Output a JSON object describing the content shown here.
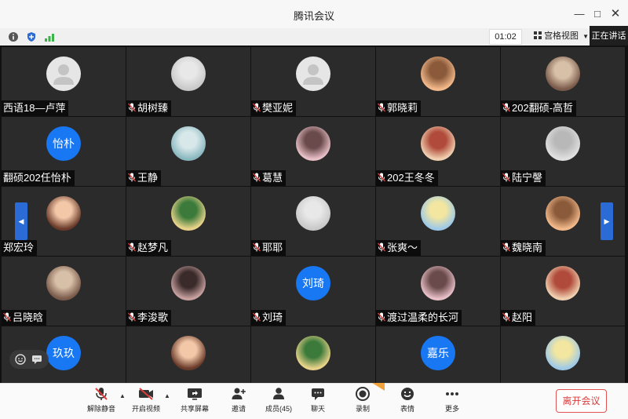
{
  "window": {
    "title": "腾讯会议"
  },
  "infobar": {
    "timer": "01:02",
    "grid_view": "宫格视图",
    "speaking": "正在讲话"
  },
  "colors": {
    "avatar_blue": "#1877f2",
    "leave_red": "#d93a3a",
    "pager_blue": "#2b6bd6",
    "signal_green": "#3cb34a"
  },
  "participants": [
    {
      "name": "西语18—卢萍",
      "avatar": "default-grey",
      "muted": false
    },
    {
      "name": "胡树臻",
      "avatar": "photo",
      "muted": true
    },
    {
      "name": "樊亚妮",
      "avatar": "default-grey",
      "muted": true
    },
    {
      "name": "郭晓莉",
      "avatar": "photo",
      "muted": true
    },
    {
      "name": "202翻硕-高哲",
      "avatar": "photo",
      "muted": true
    },
    {
      "name": "翻硕202任怡朴",
      "avatar": "text",
      "avatar_text": "怡朴",
      "muted": false
    },
    {
      "name": "王静",
      "avatar": "photo",
      "muted": true
    },
    {
      "name": "葛慧",
      "avatar": "photo",
      "muted": true
    },
    {
      "name": "202王冬冬",
      "avatar": "photo",
      "muted": true
    },
    {
      "name": "陆宁謦",
      "avatar": "photo",
      "muted": true
    },
    {
      "name": "郑宏玲",
      "avatar": "photo",
      "muted": false
    },
    {
      "name": "赵梦凡",
      "avatar": "photo",
      "muted": true
    },
    {
      "name": "耶耶",
      "avatar": "photo",
      "muted": true
    },
    {
      "name": "张爽～",
      "avatar": "photo",
      "muted": true
    },
    {
      "name": "魏晓南",
      "avatar": "photo",
      "muted": true
    },
    {
      "name": "吕晓晗",
      "avatar": "photo",
      "muted": true
    },
    {
      "name": "李浚歌",
      "avatar": "photo",
      "muted": true
    },
    {
      "name": "刘琦",
      "avatar": "text",
      "avatar_text": "刘琦",
      "muted": true
    },
    {
      "name": "渡过温柔的长河",
      "avatar": "photo",
      "muted": true
    },
    {
      "name": "赵阳",
      "avatar": "photo",
      "muted": true
    },
    {
      "name": "",
      "avatar": "text",
      "avatar_text": "玖玖",
      "muted": false
    },
    {
      "name": "",
      "avatar": "photo",
      "muted": false
    },
    {
      "name": "",
      "avatar": "photo",
      "muted": false
    },
    {
      "name": "",
      "avatar": "text",
      "avatar_text": "嘉乐",
      "muted": false
    },
    {
      "name": "",
      "avatar": "photo",
      "muted": false
    }
  ],
  "toolbar": {
    "unmute": "解除静音",
    "video": "开启视频",
    "share": "共享屏幕",
    "invite": "邀请",
    "members": "成员(45)",
    "chat": "聊天",
    "record": "录制",
    "reactions": "表情",
    "more": "更多",
    "leave": "离开会议"
  }
}
